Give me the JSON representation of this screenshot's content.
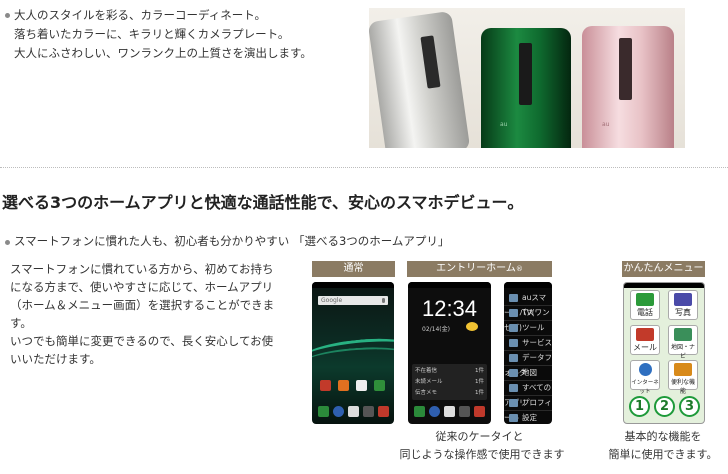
{
  "top": {
    "lines": [
      "大人のスタイルを彩る、カラーコーディネート。",
      "落ち着いたカラーに、キラリと輝くカメラプレート。",
      "大人にふさわしい、ワンランク上の上質さを演出します。"
    ],
    "phone_colors": [
      "#d9d9d6",
      "#0f6b2f",
      "#e8c2c6"
    ],
    "phone_brand": "au"
  },
  "section": {
    "heading": "選べる3つのホームアプリと快適な通話性能で、安心のスマホデビュー。",
    "bullet": "スマートフォンに慣れた人も、初心者も分かりやすい 「選べる3つのホームアプリ」",
    "body_lines": [
      "スマートフォンに慣れている方から、初めてお持ち",
      "になる方まで、使いやすさに応じて、ホームアプリ",
      "（ホーム＆メニュー画面）を選択することができま",
      "す。",
      "いつでも簡単に変更できるので、長く安心してお使",
      "いいただけます。"
    ]
  },
  "screens": {
    "normal": {
      "label": "通常",
      "search_text": "Google"
    },
    "entry": {
      "label": "エントリーホーム",
      "label_mark": "®",
      "clock": "12:34",
      "date": "02/14(金)",
      "widget_rows": [
        "不在着信",
        "未読メール",
        "伝言メモ"
      ],
      "widget_counts": [
        "1件",
        "1件",
        "1件"
      ],
      "menu": [
        "auスマートパス",
        "TV(ワンセグ)",
        "ツール",
        "サービス",
        "データフォルダ",
        "地図",
        "すべてのアプリ",
        "プロフィール",
        "設定"
      ],
      "caption": [
        "従来のケータイと",
        "同じような操作感で使用できます"
      ]
    },
    "easy": {
      "label": "かんたんメニュー",
      "tiles": [
        "電話",
        "写真",
        "メール",
        "地図・ナビ",
        "インターネット",
        "便利な機能"
      ],
      "numbers": [
        "1",
        "2",
        "3"
      ],
      "caption": [
        "基本的な機能を",
        "簡単に使用できます。"
      ]
    }
  },
  "colors": {
    "label_bg": "#8b7b63",
    "bullet": "#8a8a8a",
    "accent_green": "#1e9a3a"
  }
}
